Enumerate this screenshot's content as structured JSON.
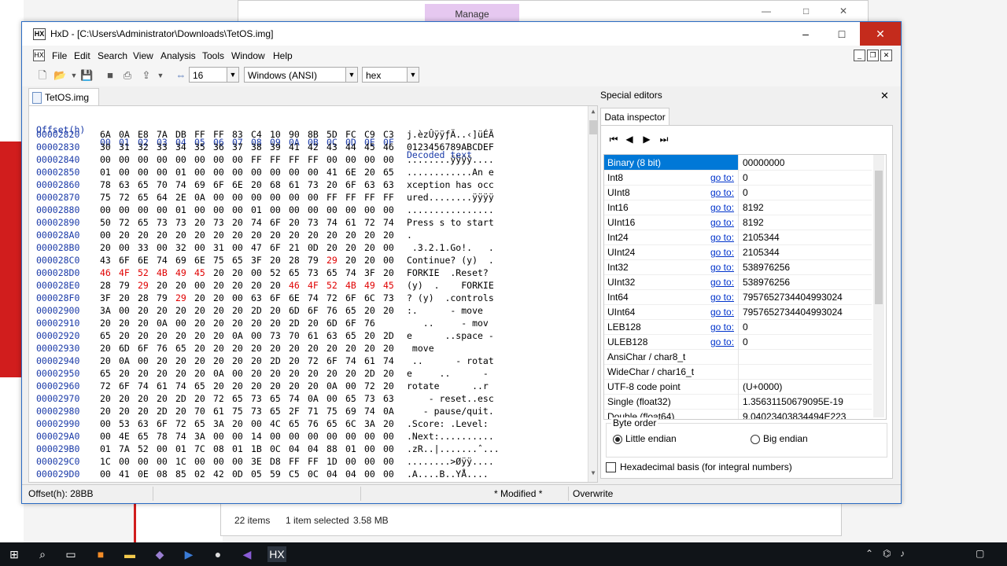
{
  "background": {
    "explorer_tab": "Manage",
    "status": {
      "items": "22 items",
      "selected": "1 item selected",
      "size": "3.58 MB"
    }
  },
  "window": {
    "title": "HxD - [C:\\Users\\Administrator\\Downloads\\TetOS.img]",
    "minimize": "–",
    "maximize": "□",
    "close": "✕"
  },
  "menu": [
    "File",
    "Edit",
    "Search",
    "View",
    "Analysis",
    "Tools",
    "Window",
    "Help"
  ],
  "toolbar": {
    "bytes_per_row": "16",
    "charset": "Windows (ANSI)",
    "offset_base": "hex"
  },
  "file_tab": "TetOS.img",
  "hex": {
    "header_offset": "Offset(h)",
    "header_columns": [
      "00",
      "01",
      "02",
      "03",
      "04",
      "05",
      "06",
      "07",
      "08",
      "09",
      "0A",
      "0B",
      "0C",
      "0D",
      "0E",
      "0F"
    ],
    "header_decoded": "Decoded text",
    "rows": [
      {
        "offset": "00002820",
        "bytes": [
          "6A",
          "0A",
          "E8",
          "7A",
          "DB",
          "FF",
          "FF",
          "83",
          "C4",
          "10",
          "90",
          "8B",
          "5D",
          "FC",
          "C9",
          "C3"
        ],
        "text": "j.èzÛÿÿƒÄ..‹]üÉÃ",
        "red": []
      },
      {
        "offset": "00002830",
        "bytes": [
          "30",
          "31",
          "32",
          "33",
          "34",
          "35",
          "36",
          "37",
          "38",
          "39",
          "41",
          "42",
          "43",
          "44",
          "45",
          "46"
        ],
        "text": "0123456789ABCDEF",
        "red": []
      },
      {
        "offset": "00002840",
        "bytes": [
          "00",
          "00",
          "00",
          "00",
          "00",
          "00",
          "00",
          "00",
          "FF",
          "FF",
          "FF",
          "FF",
          "00",
          "00",
          "00",
          "00"
        ],
        "text": "........ÿÿÿÿ....",
        "red": []
      },
      {
        "offset": "00002850",
        "bytes": [
          "01",
          "00",
          "00",
          "00",
          "01",
          "00",
          "00",
          "00",
          "00",
          "00",
          "00",
          "00",
          "41",
          "6E",
          "20",
          "65"
        ],
        "text": "............An e",
        "red": []
      },
      {
        "offset": "00002860",
        "bytes": [
          "78",
          "63",
          "65",
          "70",
          "74",
          "69",
          "6F",
          "6E",
          "20",
          "68",
          "61",
          "73",
          "20",
          "6F",
          "63",
          "63"
        ],
        "text": "xception has occ",
        "red": []
      },
      {
        "offset": "00002870",
        "bytes": [
          "75",
          "72",
          "65",
          "64",
          "2E",
          "0A",
          "00",
          "00",
          "00",
          "00",
          "00",
          "00",
          "FF",
          "FF",
          "FF",
          "FF"
        ],
        "text": "ured........ÿÿÿÿ",
        "red": []
      },
      {
        "offset": "00002880",
        "bytes": [
          "00",
          "00",
          "00",
          "00",
          "01",
          "00",
          "00",
          "00",
          "01",
          "00",
          "00",
          "00",
          "00",
          "00",
          "00",
          "00"
        ],
        "text": "................",
        "red": []
      },
      {
        "offset": "00002890",
        "bytes": [
          "50",
          "72",
          "65",
          "73",
          "73",
          "20",
          "73",
          "20",
          "74",
          "6F",
          "20",
          "73",
          "74",
          "61",
          "72",
          "74"
        ],
        "text": "Press s to start",
        "red": []
      },
      {
        "offset": "000028A0",
        "bytes": [
          "00",
          "20",
          "20",
          "20",
          "20",
          "20",
          "20",
          "20",
          "20",
          "20",
          "20",
          "20",
          "20",
          "20",
          "20",
          "20"
        ],
        "text": ".",
        "red": []
      },
      {
        "offset": "000028B0",
        "bytes": [
          "20",
          "00",
          "33",
          "00",
          "32",
          "00",
          "31",
          "00",
          "47",
          "6F",
          "21",
          "0D",
          "20",
          "20",
          "20",
          "00"
        ],
        "text": " .3.2.1.Go!.   .",
        "red": []
      },
      {
        "offset": "000028C0",
        "bytes": [
          "43",
          "6F",
          "6E",
          "74",
          "69",
          "6E",
          "75",
          "65",
          "3F",
          "20",
          "28",
          "79",
          "29",
          "20",
          "20",
          "00"
        ],
        "text": "Continue? (y)  .",
        "red": [
          12
        ]
      },
      {
        "offset": "000028D0",
        "bytes": [
          "46",
          "4F",
          "52",
          "4B",
          "49",
          "45",
          "20",
          "20",
          "00",
          "52",
          "65",
          "73",
          "65",
          "74",
          "3F",
          "20"
        ],
        "text": "FORKIE  .Reset? ",
        "red": [
          0,
          1,
          2,
          3,
          4,
          5
        ]
      },
      {
        "offset": "000028E0",
        "bytes": [
          "28",
          "79",
          "29",
          "20",
          "20",
          "00",
          "20",
          "20",
          "20",
          "20",
          "46",
          "4F",
          "52",
          "4B",
          "49",
          "45"
        ],
        "text": "(y)  .    FORKIE",
        "red": [
          2,
          10,
          11,
          12,
          13,
          14,
          15
        ]
      },
      {
        "offset": "000028F0",
        "bytes": [
          "3F",
          "20",
          "28",
          "79",
          "29",
          "20",
          "20",
          "00",
          "63",
          "6F",
          "6E",
          "74",
          "72",
          "6F",
          "6C",
          "73"
        ],
        "text": "? (y)  .controls",
        "red": [
          4
        ]
      },
      {
        "offset": "00002900",
        "bytes": [
          "3A",
          "00",
          "20",
          "20",
          "20",
          "20",
          "20",
          "20",
          "2D",
          "20",
          "6D",
          "6F",
          "76",
          "65",
          "20",
          "20"
        ],
        "text": ":.      - move  ",
        "red": []
      },
      {
        "offset": "00002910",
        "bytes": [
          "20",
          "20",
          "20",
          "0A",
          "00",
          "20",
          "20",
          "20",
          "20",
          "20",
          "2D",
          "20",
          "6D",
          "6F",
          "76",
          ""
        ],
        "text": "   ..     - mov",
        "red": []
      },
      {
        "offset": "00002920",
        "bytes": [
          "65",
          "20",
          "20",
          "20",
          "20",
          "20",
          "20",
          "0A",
          "00",
          "73",
          "70",
          "61",
          "63",
          "65",
          "20",
          "2D"
        ],
        "text": "e      ..space -",
        "red": []
      },
      {
        "offset": "00002930",
        "bytes": [
          "20",
          "6D",
          "6F",
          "76",
          "65",
          "20",
          "20",
          "20",
          "20",
          "20",
          "20",
          "20",
          "20",
          "20",
          "20",
          "20"
        ],
        "text": " move",
        "red": []
      },
      {
        "offset": "00002940",
        "bytes": [
          "20",
          "0A",
          "00",
          "20",
          "20",
          "20",
          "20",
          "20",
          "20",
          "2D",
          "20",
          "72",
          "6F",
          "74",
          "61",
          "74"
        ],
        "text": " ..      - rotat",
        "red": []
      },
      {
        "offset": "00002950",
        "bytes": [
          "65",
          "20",
          "20",
          "20",
          "20",
          "20",
          "0A",
          "00",
          "20",
          "20",
          "20",
          "20",
          "20",
          "20",
          "2D",
          "20"
        ],
        "text": "e     ..      - ",
        "red": []
      },
      {
        "offset": "00002960",
        "bytes": [
          "72",
          "6F",
          "74",
          "61",
          "74",
          "65",
          "20",
          "20",
          "20",
          "20",
          "20",
          "20",
          "0A",
          "00",
          "72",
          "20"
        ],
        "text": "rotate      ..r ",
        "red": []
      },
      {
        "offset": "00002970",
        "bytes": [
          "20",
          "20",
          "20",
          "20",
          "2D",
          "20",
          "72",
          "65",
          "73",
          "65",
          "74",
          "0A",
          "00",
          "65",
          "73",
          "63"
        ],
        "text": "    - reset..esc",
        "red": []
      },
      {
        "offset": "00002980",
        "bytes": [
          "20",
          "20",
          "20",
          "2D",
          "20",
          "70",
          "61",
          "75",
          "73",
          "65",
          "2F",
          "71",
          "75",
          "69",
          "74",
          "0A"
        ],
        "text": "   - pause/quit.",
        "red": []
      },
      {
        "offset": "00002990",
        "bytes": [
          "00",
          "53",
          "63",
          "6F",
          "72",
          "65",
          "3A",
          "20",
          "00",
          "4C",
          "65",
          "76",
          "65",
          "6C",
          "3A",
          "20"
        ],
        "text": ".Score: .Level: ",
        "red": []
      },
      {
        "offset": "000029A0",
        "bytes": [
          "00",
          "4E",
          "65",
          "78",
          "74",
          "3A",
          "00",
          "00",
          "14",
          "00",
          "00",
          "00",
          "00",
          "00",
          "00",
          "00"
        ],
        "text": ".Next:..........",
        "red": []
      },
      {
        "offset": "000029B0",
        "bytes": [
          "01",
          "7A",
          "52",
          "00",
          "01",
          "7C",
          "08",
          "01",
          "1B",
          "0C",
          "04",
          "04",
          "88",
          "01",
          "00",
          "00"
        ],
        "text": ".zR..|.......ˆ...",
        "red": []
      },
      {
        "offset": "000029C0",
        "bytes": [
          "1C",
          "00",
          "00",
          "00",
          "1C",
          "00",
          "00",
          "00",
          "3E",
          "D8",
          "FF",
          "FF",
          "1D",
          "00",
          "00",
          "00"
        ],
        "text": "........>Øÿÿ....",
        "red": []
      },
      {
        "offset": "000029D0",
        "bytes": [
          "00",
          "41",
          "0E",
          "08",
          "85",
          "02",
          "42",
          "0D",
          "05",
          "59",
          "C5",
          "0C",
          "04",
          "04",
          "00",
          "00"
        ],
        "text": ".A....B..YÅ....",
        "red": []
      }
    ]
  },
  "inspector": {
    "panel_title": "Special editors",
    "tab": "Data inspector",
    "goto_label": "go to:",
    "rows": [
      {
        "name": "Binary (8 bit)",
        "value": "00000000",
        "goto": false
      },
      {
        "name": "Int8",
        "value": "0",
        "goto": true
      },
      {
        "name": "UInt8",
        "value": "0",
        "goto": true
      },
      {
        "name": "Int16",
        "value": "8192",
        "goto": true
      },
      {
        "name": "UInt16",
        "value": "8192",
        "goto": true
      },
      {
        "name": "Int24",
        "value": "2105344",
        "goto": true
      },
      {
        "name": "UInt24",
        "value": "2105344",
        "goto": true
      },
      {
        "name": "Int32",
        "value": "538976256",
        "goto": true
      },
      {
        "name": "UInt32",
        "value": "538976256",
        "goto": true
      },
      {
        "name": "Int64",
        "value": "7957652734404993024",
        "goto": true
      },
      {
        "name": "UInt64",
        "value": "7957652734404993024",
        "goto": true
      },
      {
        "name": "LEB128",
        "value": "0",
        "goto": true
      },
      {
        "name": "ULEB128",
        "value": "0",
        "goto": true
      },
      {
        "name": "AnsiChar / char8_t",
        "value": "",
        "goto": false
      },
      {
        "name": "WideChar / char16_t",
        "value": "",
        "goto": false
      },
      {
        "name": "UTF-8 code point",
        "value": "  (U+0000)",
        "goto": false
      },
      {
        "name": "Single (float32)",
        "value": "1.35631150679095E-19",
        "goto": false
      },
      {
        "name": "Double (float64)",
        "value": "9.04023403834494E223",
        "goto": false
      }
    ],
    "byte_order_label": "Byte order",
    "little_endian": "Little endian",
    "big_endian": "Big endian",
    "hex_basis": "Hexadecimal basis (for integral numbers)"
  },
  "status": {
    "offset": "Offset(h): 28BB",
    "modified": "* Modified *",
    "mode": "Overwrite"
  }
}
